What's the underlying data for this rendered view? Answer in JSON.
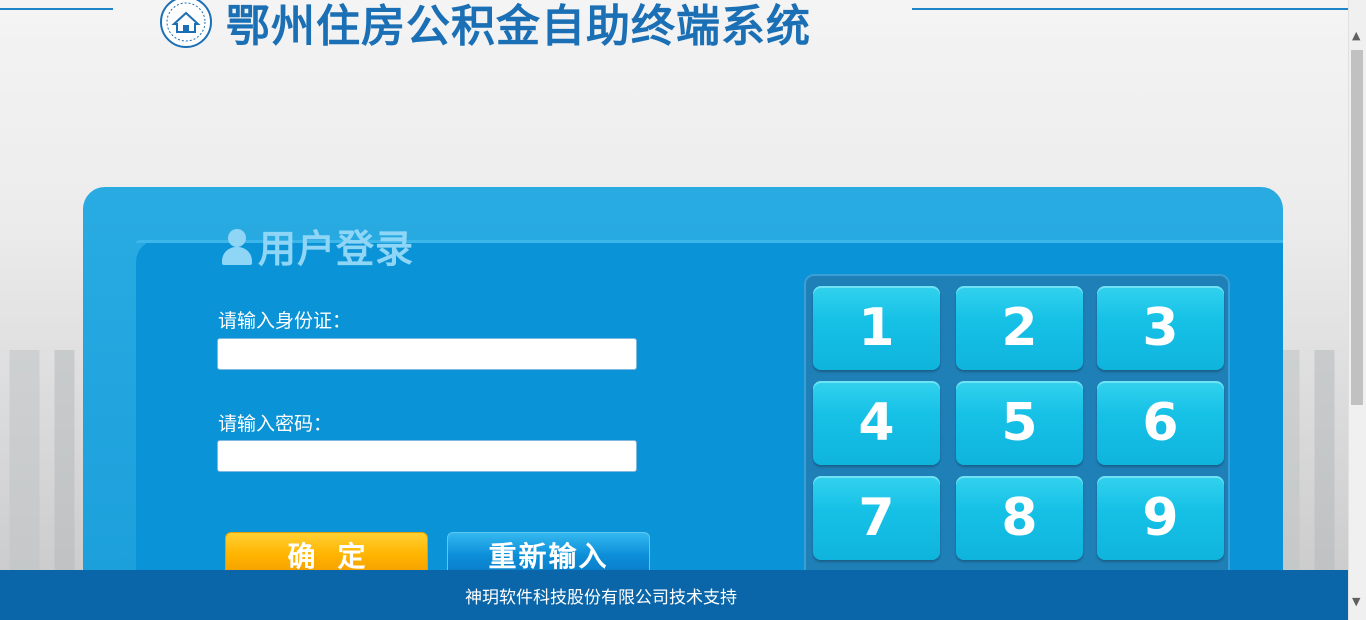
{
  "header": {
    "title": "鄂州住房公积金自助终端系统",
    "logo_icon": "housing-fund-logo-icon"
  },
  "login": {
    "title": "用户登录",
    "user_icon": "user-icon",
    "id_label": "请输入身份证：",
    "id_value": "",
    "password_label": "请输入密码：",
    "password_value": "",
    "confirm_label": "确定",
    "reset_label": "重新输入"
  },
  "keypad": {
    "keys": [
      "1",
      "2",
      "3",
      "4",
      "5",
      "6",
      "7",
      "8",
      "9"
    ]
  },
  "footer": {
    "text": "神玥软件科技股份有限公司技术支持"
  },
  "colors": {
    "title_blue": "#1a6fb5",
    "panel_blue": "#0a93d6",
    "key_cyan": "#16c1e6",
    "confirm_orange": "#ffb400",
    "footer_blue": "#0a66a8"
  }
}
